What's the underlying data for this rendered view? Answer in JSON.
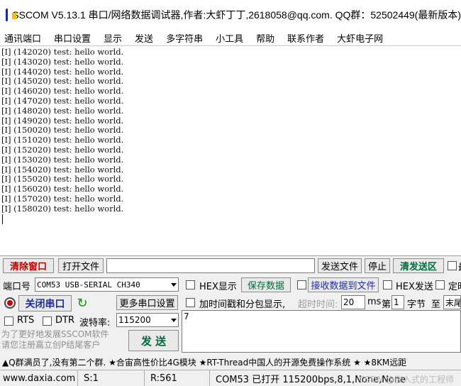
{
  "window": {
    "title": "SSCOM V5.13.1 串口/网络数据调试器,作者:大虾丁丁,2618058@qq.com. QQ群：52502449(最新版本)"
  },
  "menu": [
    "通讯端口",
    "串口设置",
    "显示",
    "发送",
    "多字符串",
    "小工具",
    "帮助",
    "联系作者",
    "大虾电子网"
  ],
  "receive": {
    "lines": [
      "[I] (142020) test: hello world.",
      "[I] (143020) test: hello world.",
      "[I] (144020) test: hello world.",
      "[I] (145020) test: hello world.",
      "[I] (146020) test: hello world.",
      "[I] (147020) test: hello world.",
      "[I] (148020) test: hello world.",
      "[I] (149020) test: hello world.",
      "[I] (150020) test: hello world.",
      "[I] (151020) test: hello world.",
      "[I] (152020) test: hello world.",
      "[I] (153020) test: hello world.",
      "[I] (154020) test: hello world.",
      "[I] (155020) test: hello world.",
      "[I] (156020) test: hello world.",
      "[I] (157020) test: hello world.",
      "[I] (158020) test: hello world."
    ]
  },
  "toolbar": {
    "clear_window": "清除窗口",
    "open_file": "打开文件",
    "send_file": "发送文件",
    "stop": "停止",
    "clear_send": "清发送区",
    "last_label": "最"
  },
  "port": {
    "label": "端口号",
    "value": "COM53 USB-SERIAL CH340",
    "close_button": "关闭串口",
    "more_settings": "更多串口设置",
    "rts": "RTS",
    "dtr": "DTR",
    "baud_label": "波特率:",
    "baud_value": "115200"
  },
  "options": {
    "hex_display": "HEX显示",
    "save_data": "保存数据",
    "recv_to_file": "接收数据到文件",
    "hex_send": "HEX发送",
    "timed": "定时",
    "timestamp": "加时间戳和分包显示,",
    "timeout_label": "超时时间:",
    "timeout_value": "20",
    "ms": "ms",
    "di": "第",
    "byte_index": "1",
    "byte_label": "字节",
    "to_label": "至",
    "end_value": "末尾"
  },
  "send": {
    "text": "7",
    "button": "发 送",
    "promo": "为了更好地发展SSCOM软件\n请您注册嘉立创P结尾客户"
  },
  "ad_line": "▲Q群满员了,没有第二个群. ★合宙高性价比4G模块 ★RT-Thread中国人的开源免费操作系统 ★ ★8KM远距",
  "status": {
    "site": "www.daxia.com",
    "s": "S:1",
    "r": "R:561",
    "port_state": "COM53 已打开  115200bps,8,1,None,None",
    "watermark": "CSDN @嵌入式的工程师"
  }
}
